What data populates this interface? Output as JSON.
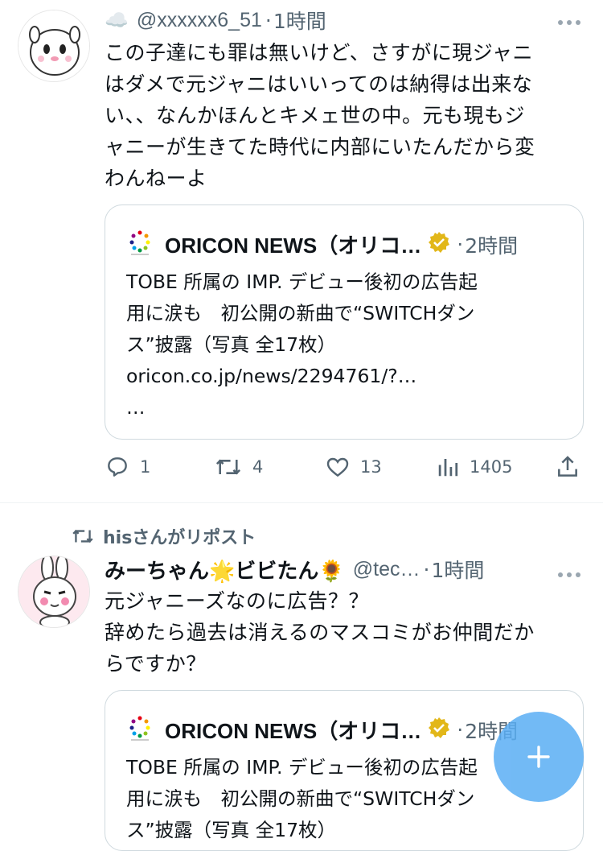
{
  "tweet1": {
    "emoji": "☁️",
    "handle": "@xxxxxx6_51",
    "sep": "·",
    "time": "1時間",
    "text_lines": [
      "この子達にも罪は無いけど、さすがに現ジャニ",
      "はダメで元ジャニはいいってのは納得は出来な",
      "い、、なんかほんとキメェ世の中。元も現もジ",
      "ャニーが生きてた時代に内部にいたんだから変",
      "わんねーよ"
    ],
    "quote": {
      "name": "ORICON NEWS（オリコ…",
      "sep": "·",
      "time": "2時間",
      "body_lines": [
        "TOBE 所属の IMP. デビュー後初の広告起",
        "用に涙も　初公開の新曲で“SWITCHダン",
        "ス”披露（写真 全17枚）",
        "oricon.co.jp/news/2294761/?…",
        "…"
      ]
    },
    "actions": {
      "replies": "1",
      "retweets": "4",
      "likes": "13",
      "views": "1405"
    }
  },
  "tweet2": {
    "repost_label": "hisさんがリポスト",
    "name": "みーちゃん🌟ビビたん🌻",
    "handle": "@tec…",
    "sep": "·",
    "time": "1時間",
    "text_lines": [
      "元ジャニーズなのに広告？？",
      "辞めたら過去は消えるのマスコミがお仲間だか",
      "らですか？"
    ],
    "quote": {
      "name": "ORICON NEWS（オリコ…",
      "sep": "·",
      "time": "2時間",
      "body_lines": [
        "TOBE 所属の IMP. デビュー後初の広告起",
        "用に涙も　初公開の新曲で“SWITCHダン",
        "ス”披露（写真 全17枚）"
      ]
    }
  },
  "colors": {
    "accent": "#1d9bf0",
    "muted": "#536471",
    "border": "#cfd9de",
    "fab": "#5aaef4",
    "verified": "#e2b719"
  },
  "icons": [
    "more-icon",
    "reply-icon",
    "retweet-icon",
    "like-icon",
    "views-icon",
    "share-icon",
    "verified-badge-icon",
    "repost-icon",
    "compose-plus-icon",
    "oricon-logo"
  ]
}
